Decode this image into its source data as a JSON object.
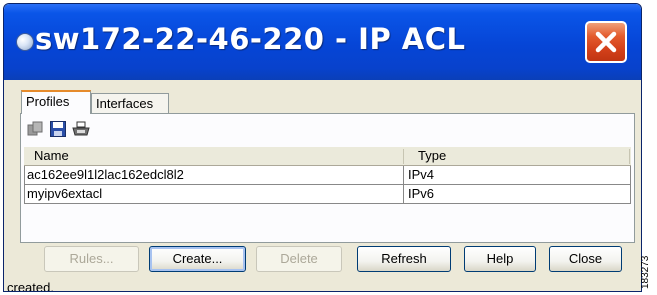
{
  "window": {
    "title": "sw172-22-46-220 - IP ACL",
    "close_symbol": "✕"
  },
  "tabs": [
    {
      "label": "Profiles",
      "active": true
    },
    {
      "label": "Interfaces",
      "active": false
    }
  ],
  "toolbar": {
    "icons": [
      "copy-icon",
      "save-icon",
      "print-icon"
    ]
  },
  "table": {
    "columns": [
      "Name",
      "Type"
    ],
    "rows": [
      {
        "name": "ac162ee9l1l2lac162edcl8l2",
        "type": "IPv4"
      },
      {
        "name": "myipv6extacl",
        "type": "IPv6"
      }
    ]
  },
  "buttons": {
    "rules": "Rules...",
    "create": "Create...",
    "delete": "Delete",
    "refresh": "Refresh",
    "help": "Help",
    "close": "Close"
  },
  "status": "created.",
  "side_label": "183273",
  "colors": {
    "titlebar": "#0645d6",
    "close_button": "#d3401a",
    "active_tab_accent": "#e68b2c",
    "window_bg": "#ece9d8"
  }
}
